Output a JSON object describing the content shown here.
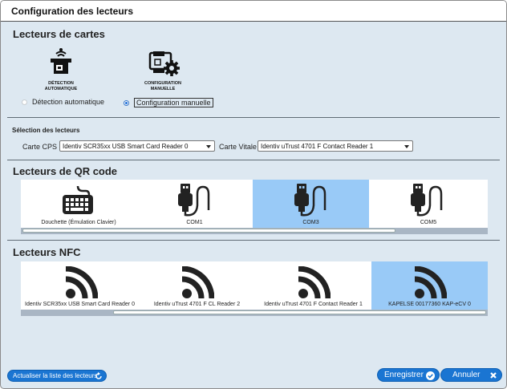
{
  "window": {
    "title": "Configuration des lecteurs"
  },
  "card_readers": {
    "section_title": "Lecteurs de cartes",
    "modes": [
      {
        "caption_line1": "DÉTECTION",
        "caption_line2": "AUTOMATIQUE",
        "icon": "auto-detect-reader-icon"
      },
      {
        "caption_line1": "CONFIGURATION",
        "caption_line2": "MANUELLE",
        "icon": "manual-config-reader-icon"
      }
    ],
    "radios": [
      {
        "label": "Détection automatique",
        "selected": false
      },
      {
        "label": "Configuration manuelle",
        "selected": true
      }
    ]
  },
  "selection": {
    "title": "Sélection des lecteurs",
    "cps_label": "Carte CPS",
    "cps_value": "Identiv SCR35xx USB Smart Card Reader 0",
    "vitale_label": "Carte Vitale",
    "vitale_value": "Identiv uTrust 4701 F Contact Reader 1"
  },
  "qr": {
    "section_title": "Lecteurs de QR code",
    "items": [
      {
        "label": "Douchette (Émulation Clavier)",
        "icon": "keyboard-icon",
        "selected": false
      },
      {
        "label": "COM1",
        "icon": "usb-plug-icon",
        "selected": false
      },
      {
        "label": "COM3",
        "icon": "usb-plug-icon",
        "selected": true
      },
      {
        "label": "COM5",
        "icon": "usb-plug-icon",
        "selected": false
      }
    ]
  },
  "nfc": {
    "section_title": "Lecteurs NFC",
    "items": [
      {
        "label": "Identiv SCR35xx USB Smart Card Reader 0",
        "icon": "wifi-signal-icon",
        "selected": false
      },
      {
        "label": "Identiv uTrust 4701 F CL Reader 2",
        "icon": "wifi-signal-icon",
        "selected": false
      },
      {
        "label": "Identiv uTrust 4701 F Contact Reader 1",
        "icon": "wifi-signal-icon",
        "selected": false
      },
      {
        "label": "KAPELSE 00177360 KAP-eCV 0",
        "icon": "wifi-signal-icon",
        "selected": true
      }
    ]
  },
  "footer": {
    "refresh_label": "Actualiser la liste des lecteurs",
    "save_label": "Enregistrer",
    "cancel_label": "Annuler"
  },
  "colors": {
    "accent": "#1a75d2",
    "selected_tile": "#99caf7",
    "background": "#dde8f1"
  }
}
